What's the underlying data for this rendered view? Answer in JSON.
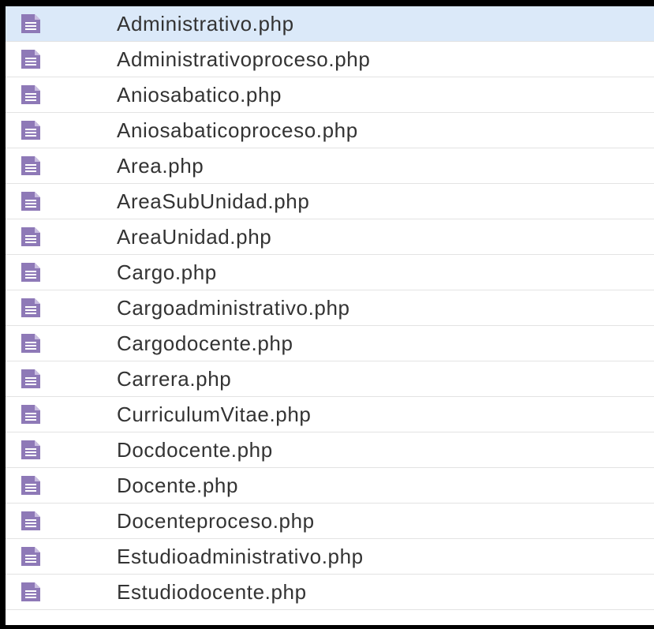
{
  "icon_color": "#8e79b7",
  "selected_row_color": "#dbe9f9",
  "files": [
    {
      "name": "Administrativo.php",
      "icon": "document-icon",
      "selected": true
    },
    {
      "name": "Administrativoproceso.php",
      "icon": "document-icon",
      "selected": false
    },
    {
      "name": "Aniosabatico.php",
      "icon": "document-icon",
      "selected": false
    },
    {
      "name": "Aniosabaticoproceso.php",
      "icon": "document-icon",
      "selected": false
    },
    {
      "name": "Area.php",
      "icon": "document-icon",
      "selected": false
    },
    {
      "name": "AreaSubUnidad.php",
      "icon": "document-icon",
      "selected": false
    },
    {
      "name": "AreaUnidad.php",
      "icon": "document-icon",
      "selected": false
    },
    {
      "name": "Cargo.php",
      "icon": "document-icon",
      "selected": false
    },
    {
      "name": "Cargoadministrativo.php",
      "icon": "document-icon",
      "selected": false
    },
    {
      "name": "Cargodocente.php",
      "icon": "document-icon",
      "selected": false
    },
    {
      "name": "Carrera.php",
      "icon": "document-icon",
      "selected": false
    },
    {
      "name": "CurriculumVitae.php",
      "icon": "document-icon",
      "selected": false
    },
    {
      "name": "Docdocente.php",
      "icon": "document-icon",
      "selected": false
    },
    {
      "name": "Docente.php",
      "icon": "document-icon",
      "selected": false
    },
    {
      "name": "Docenteproceso.php",
      "icon": "document-icon",
      "selected": false
    },
    {
      "name": "Estudioadministrativo.php",
      "icon": "document-icon",
      "selected": false
    },
    {
      "name": "Estudiodocente.php",
      "icon": "document-icon",
      "selected": false
    }
  ]
}
